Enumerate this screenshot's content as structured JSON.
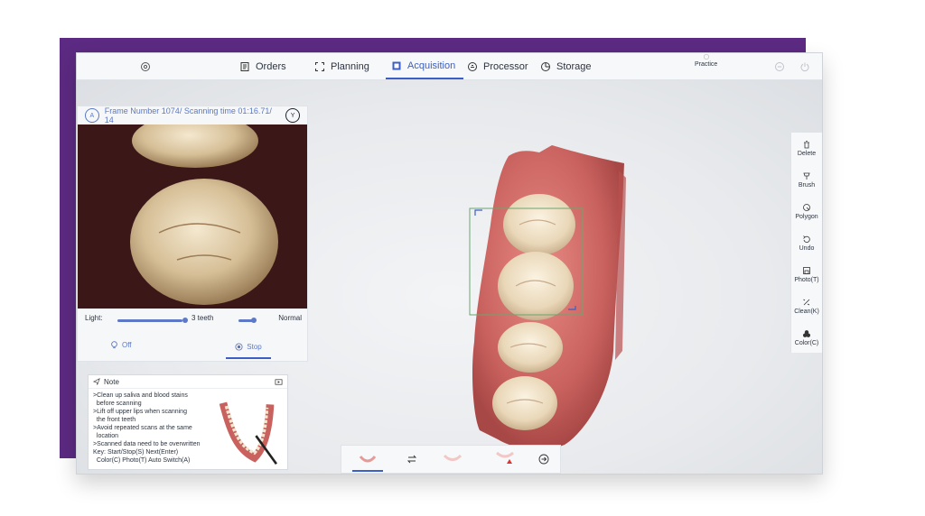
{
  "nav": {
    "orders": "Orders",
    "planning": "Planning",
    "acquisition": "Acquisition",
    "processor": "Processor",
    "storage": "Storage",
    "practice": "Practice"
  },
  "scan": {
    "badge_left": "A",
    "frame_text": "Frame Number 1074/ Scanning time 01:16.71/ 14",
    "badge_right": "Y",
    "light_label": "Light:",
    "teeth_label": "3 teeth",
    "mode_label": "Normal",
    "off_label": "Off",
    "stop_label": "Stop"
  },
  "note": {
    "title": "Note",
    "lines": [
      ">Clean up saliva and blood stains",
      "  before scanning",
      ">Lift off upper lips when scanning",
      "  the front teeth",
      ">Avoid repeated scans at the same",
      "  location",
      ">Scanned data need to be overwritten",
      "Key: Start/Stop(S) Next(Enter)",
      "  Color(C) Photo(T) Auto Switch(A)"
    ]
  },
  "tools": [
    {
      "label": "Delete",
      "icon": "trash-icon"
    },
    {
      "label": "Brush",
      "icon": "brush-icon"
    },
    {
      "label": "Polygon",
      "icon": "polygon-icon"
    },
    {
      "label": "Undo",
      "icon": "undo-icon"
    },
    {
      "label": "Photo(T)",
      "icon": "photo-icon"
    },
    {
      "label": "Clean(K)",
      "icon": "clean-icon"
    },
    {
      "label": "Color(C)",
      "icon": "color-icon"
    }
  ],
  "colors": {
    "accent": "#3b5fc4",
    "frame": "#5c2a82"
  }
}
